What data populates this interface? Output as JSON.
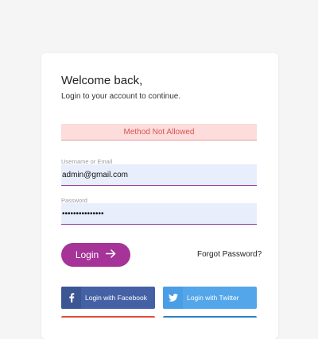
{
  "header": {
    "title": "Welcome back,",
    "subtitle": "Login to your account to continue."
  },
  "alert": {
    "message": "Method Not Allowed"
  },
  "form": {
    "username_label": "Username or Email",
    "username_value": "admin@gmail.com",
    "password_label": "Password",
    "password_value": "•••••••••••••••"
  },
  "actions": {
    "login_label": "Login",
    "forgot_label": "Forgot Password?"
  },
  "social": {
    "facebook_label": "Login with Facebook",
    "twitter_label": "Login with Twitter"
  },
  "icons": {
    "login_arrow": "arrow-right-icon",
    "facebook": "facebook-icon",
    "twitter": "twitter-icon"
  },
  "colors": {
    "accent": "#a63397",
    "error_bg": "#fddcdc",
    "error_text": "#d9534f",
    "facebook": "#4561a5",
    "twitter": "#53a6ea",
    "field_bg": "#e8eefb"
  }
}
